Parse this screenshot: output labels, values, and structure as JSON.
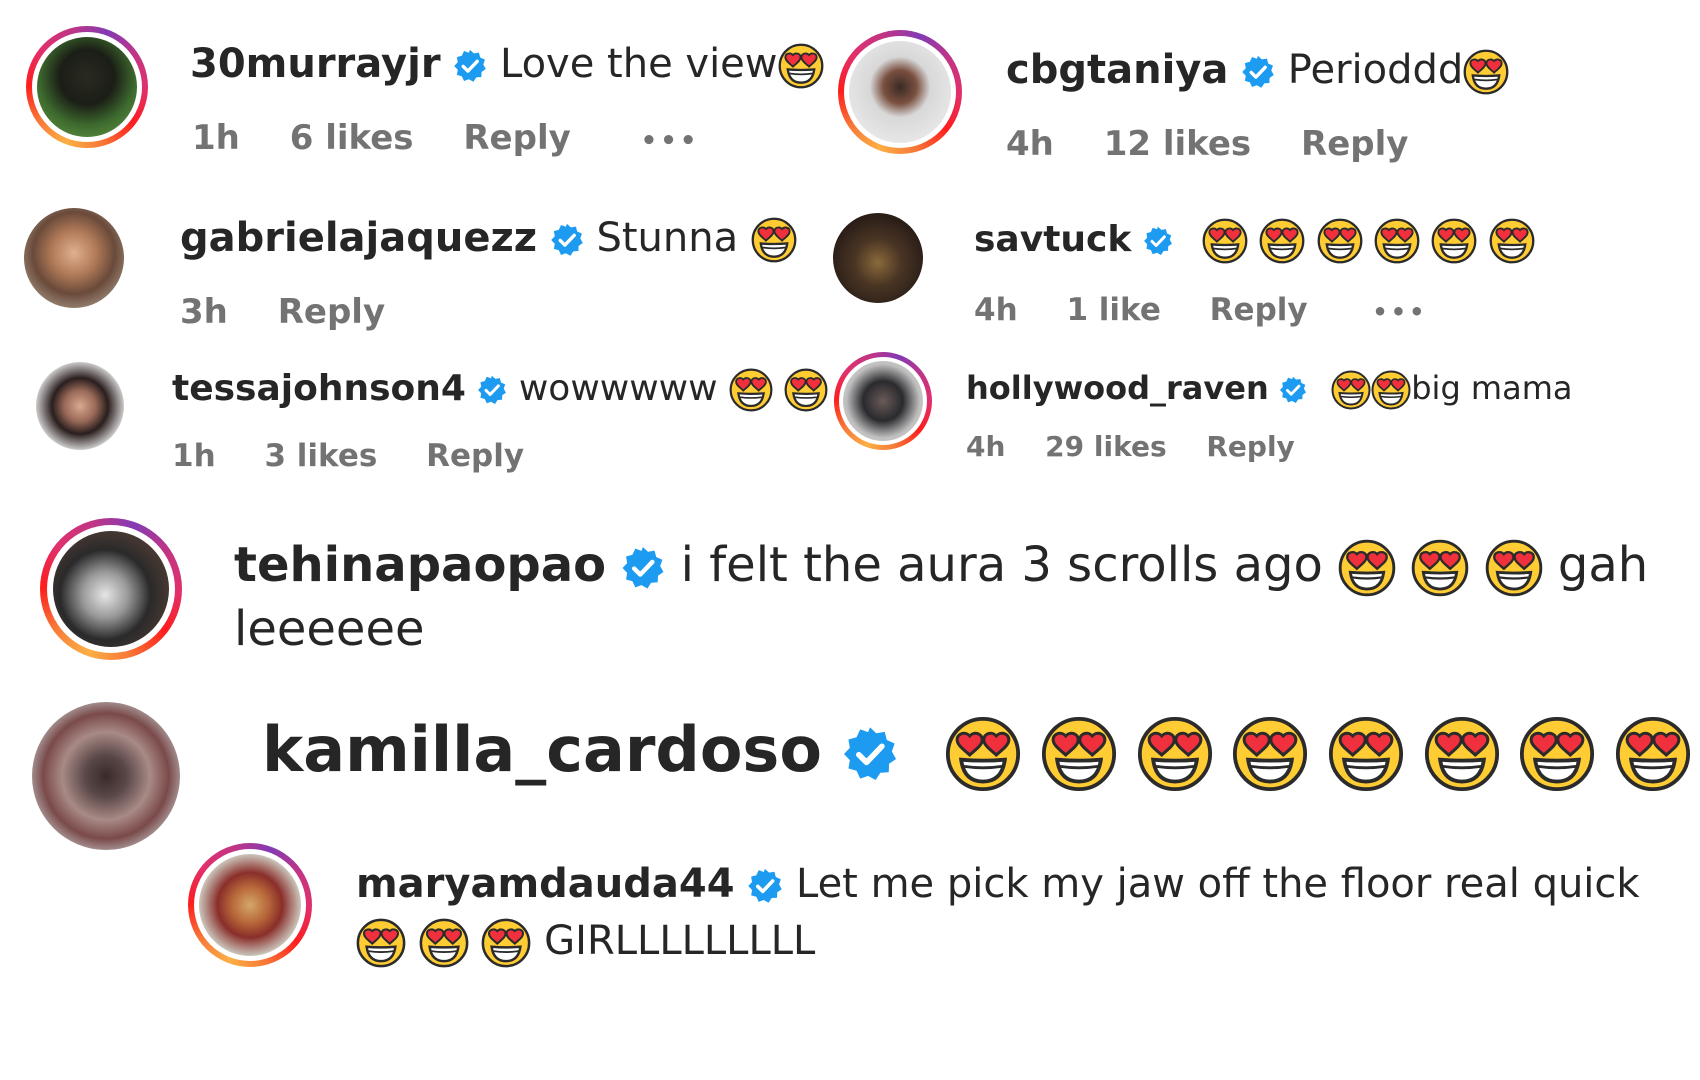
{
  "comments": [
    {
      "username": "30murrayjr",
      "text": "Love the view",
      "emoji_count_after": 1,
      "time": "1h",
      "likes": "6 likes",
      "reply": "Reply",
      "more": "•••"
    },
    {
      "username": "cbgtaniya",
      "text": "Perioddd",
      "emoji_count_after": 1,
      "time": "4h",
      "likes": "12 likes",
      "reply": "Reply"
    },
    {
      "username": "gabrielajaquezz",
      "text": "Stunna",
      "emoji_count_after": 1,
      "time": "3h",
      "reply": "Reply"
    },
    {
      "username": "savtuck",
      "text": "",
      "emoji_count_after": 6,
      "time": "4h",
      "likes": "1 like",
      "reply": "Reply",
      "more": "•••"
    },
    {
      "username": "tessajohnson4",
      "text": "wowwwww",
      "emoji_count_after": 2,
      "time": "1h",
      "likes": "3 likes",
      "reply": "Reply"
    },
    {
      "username": "hollywood_raven",
      "text": "big mama",
      "emoji_count_before": 2,
      "time": "4h",
      "likes": "29 likes",
      "reply": "Reply"
    },
    {
      "username": "tehinapaopao",
      "text": "i felt the aura 3 scrolls ago",
      "emoji_count_after": 3,
      "text_after": "gah",
      "text_line2": "leeeeee"
    },
    {
      "username": "kamilla_cardoso",
      "text": "",
      "emoji_count_after": 8
    },
    {
      "username": "maryamdauda44",
      "text": "Let me pick my jaw off the floor real quick",
      "emoji_count_line2": 3,
      "text_line2": "GIRLLLLLLLLL"
    }
  ],
  "icons": {
    "verified": "verified-badge-icon",
    "emoji": "heart-eyes-emoji-icon"
  },
  "colors": {
    "verified": "#1d9bf0",
    "username": "#262626",
    "meta": "#737373",
    "emoji_face": "#ffcc33",
    "emoji_heart": "#f0303c"
  }
}
